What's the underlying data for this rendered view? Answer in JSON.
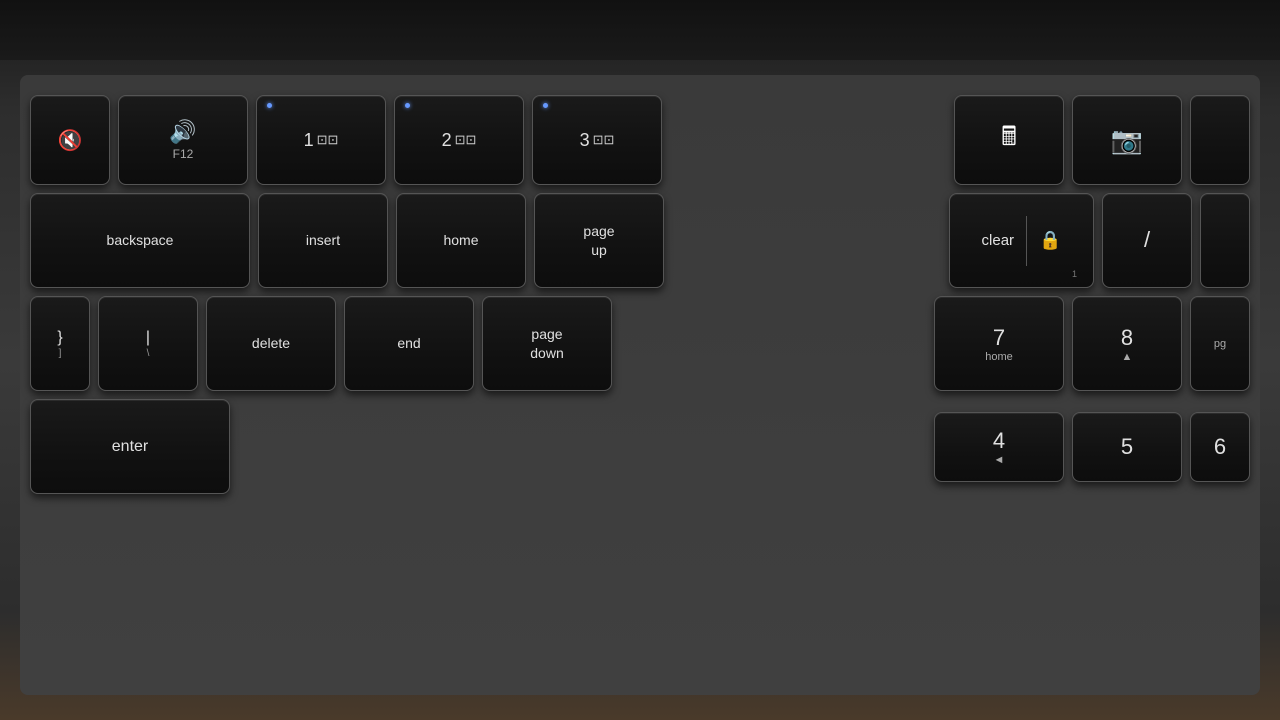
{
  "keyboard": {
    "title": "Keyboard close-up photo",
    "surface_color": "#3a3a3a",
    "rows": [
      {
        "id": "row1",
        "keys": [
          {
            "id": "mute",
            "label": "",
            "icon": "mute-icon",
            "sublabel": ""
          },
          {
            "id": "vol-down",
            "label": "",
            "icon": "vol-down-icon",
            "sublabel": "F12"
          },
          {
            "id": "display1",
            "label": "1",
            "icon": "display-icon",
            "has_dot": true
          },
          {
            "id": "display2",
            "label": "2",
            "icon": "display-icon",
            "has_dot": true
          },
          {
            "id": "display3",
            "label": "3",
            "icon": "display-icon",
            "has_dot": true
          },
          {
            "id": "gap"
          },
          {
            "id": "calc",
            "label": "",
            "icon": "calculator-icon"
          },
          {
            "id": "screenshot",
            "label": "",
            "icon": "camera-icon"
          },
          {
            "id": "partial-r1",
            "label": ""
          }
        ]
      },
      {
        "id": "row2",
        "keys": [
          {
            "id": "backspace",
            "label": "backspace"
          },
          {
            "id": "insert",
            "label": "insert"
          },
          {
            "id": "home",
            "label": "home"
          },
          {
            "id": "pageup",
            "label": "page\nup"
          },
          {
            "id": "gap2"
          },
          {
            "id": "clear",
            "label": "clear",
            "has_lock": true
          },
          {
            "id": "slash",
            "label": "/"
          },
          {
            "id": "partial-r2",
            "label": ""
          }
        ]
      },
      {
        "id": "row3",
        "keys": [
          {
            "id": "brace",
            "label": "}]"
          },
          {
            "id": "backslash",
            "label": "|\\"
          },
          {
            "id": "delete",
            "label": "delete"
          },
          {
            "id": "end",
            "label": "end"
          },
          {
            "id": "pagedown",
            "label": "page\ndown"
          },
          {
            "id": "gap3"
          },
          {
            "id": "num7",
            "label": "7",
            "sublabel": "home"
          },
          {
            "id": "num8",
            "label": "8",
            "sublabel": "▲"
          },
          {
            "id": "partial-r3",
            "label": "pg"
          }
        ]
      },
      {
        "id": "row4",
        "keys": [
          {
            "id": "enter",
            "label": "enter"
          },
          {
            "id": "num4",
            "label": "4",
            "sublabel": "◄"
          },
          {
            "id": "num5",
            "label": "5"
          },
          {
            "id": "num6",
            "label": "6"
          }
        ]
      }
    ]
  }
}
